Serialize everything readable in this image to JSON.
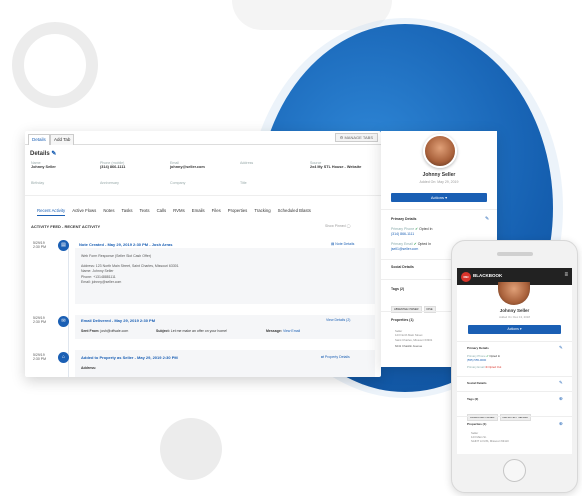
{
  "desktop": {
    "tabs": [
      "Details",
      "Add Tab"
    ],
    "manage_tabs": "MANAGE TABS",
    "details_title": "Details",
    "fields": [
      {
        "label": "Name",
        "value": "Johnny Seller"
      },
      {
        "label": "Phone (mobile)",
        "value": "(314) 866-1111"
      },
      {
        "label": "Email",
        "value": "johnny@seller.com"
      },
      {
        "label": "Address",
        "value": ""
      },
      {
        "label": "Source",
        "value": "2x4 My STL House - Website"
      },
      {
        "label": "Birthday",
        "value": ""
      },
      {
        "label": "Anniversary",
        "value": ""
      },
      {
        "label": "Company",
        "value": ""
      },
      {
        "label": "Title",
        "value": ""
      }
    ],
    "nav": [
      "Recent Activity",
      "Active Flows",
      "Notes",
      "Tasks",
      "Texts",
      "Calls",
      "RVMs",
      "Emails",
      "Files",
      "Properties",
      "Tracking",
      "Scheduled Blasts"
    ],
    "feed_title": "ACTIVITY FEED - RECENT ACTIVITY",
    "show_pinned": "Show Pinned",
    "activities": [
      {
        "date": "5/29/19",
        "time": "2:30 PM",
        "title": "Note Created - May 29, 2019 2:30 PM - Josh Arras",
        "action": "Note Details",
        "lines": [
          "Web Form Response (Seller Slot Cash Offer)",
          "",
          "Address: 123 North Main Street, Saint Charles, Missouri 63301",
          "Name: Johnny Seller",
          "Phone: +13148881111",
          "Email: johnny@seller.com"
        ]
      },
      {
        "date": "5/29/19",
        "time": "2:30 PM",
        "title": "Email Delivered - May 29, 2019 2:30 PM",
        "action": "View Details (2)",
        "sent_from_label": "Sent From:",
        "sent_from": "josh@offsale.com",
        "subject_label": "Subject:",
        "subject": "Let me make an offer on your home!",
        "message_label": "Message:",
        "message": "View Email"
      },
      {
        "date": "5/29/19",
        "time": "2:30 PM",
        "title": "Added to Property as Seller - May 29, 2019 2:30 PM",
        "action": "Property Details",
        "lines": [
          "Address:"
        ]
      }
    ],
    "contact": {
      "name": "Johnny Seller",
      "added": "Added On: May 29, 2019",
      "actions": "Actions",
      "primary_details": "Primary Details",
      "phone_label": "Primary Phone",
      "phone_status": "Opted In",
      "phone": "(314) 866-1111",
      "email_label": "Primary Email",
      "email_status": "Opted In",
      "email": "jsell1@seller.com",
      "social": "Social Details",
      "tags": "Tags (2)",
      "tag_items": [
        "ABSENTEE OWNER",
        "DISE"
      ],
      "properties": "Properties (1)",
      "prop_role": "Seller",
      "prop_addr": [
        "123 North Main Street",
        "Saint Charles, Missouri 63301"
      ],
      "prop2": "6241 Chastlin Avenue"
    }
  },
  "phone": {
    "brand": "BLACKBOOK",
    "brand_mark": "REI",
    "name": "Johnny Seller",
    "added": "Added On: Dec 13, 2018",
    "actions": "Actions",
    "primary_details": "Primary Details",
    "phone_label": "Primary Phone",
    "phone_status": "Opted In",
    "phone": "(555) 555-0000",
    "email_label": "Primary Email",
    "email_status": "Opted Out",
    "social": "Social Details",
    "tags": "Tags (2)",
    "tag_items": [
      "ABSENTEE OWNER",
      "DEFINITELY SELLER"
    ],
    "properties": "Properties (1)",
    "prop_role": "Seller",
    "prop_addr": [
      "123 Main St.",
      "SAINT LOUIS, Missouri 63110"
    ]
  }
}
